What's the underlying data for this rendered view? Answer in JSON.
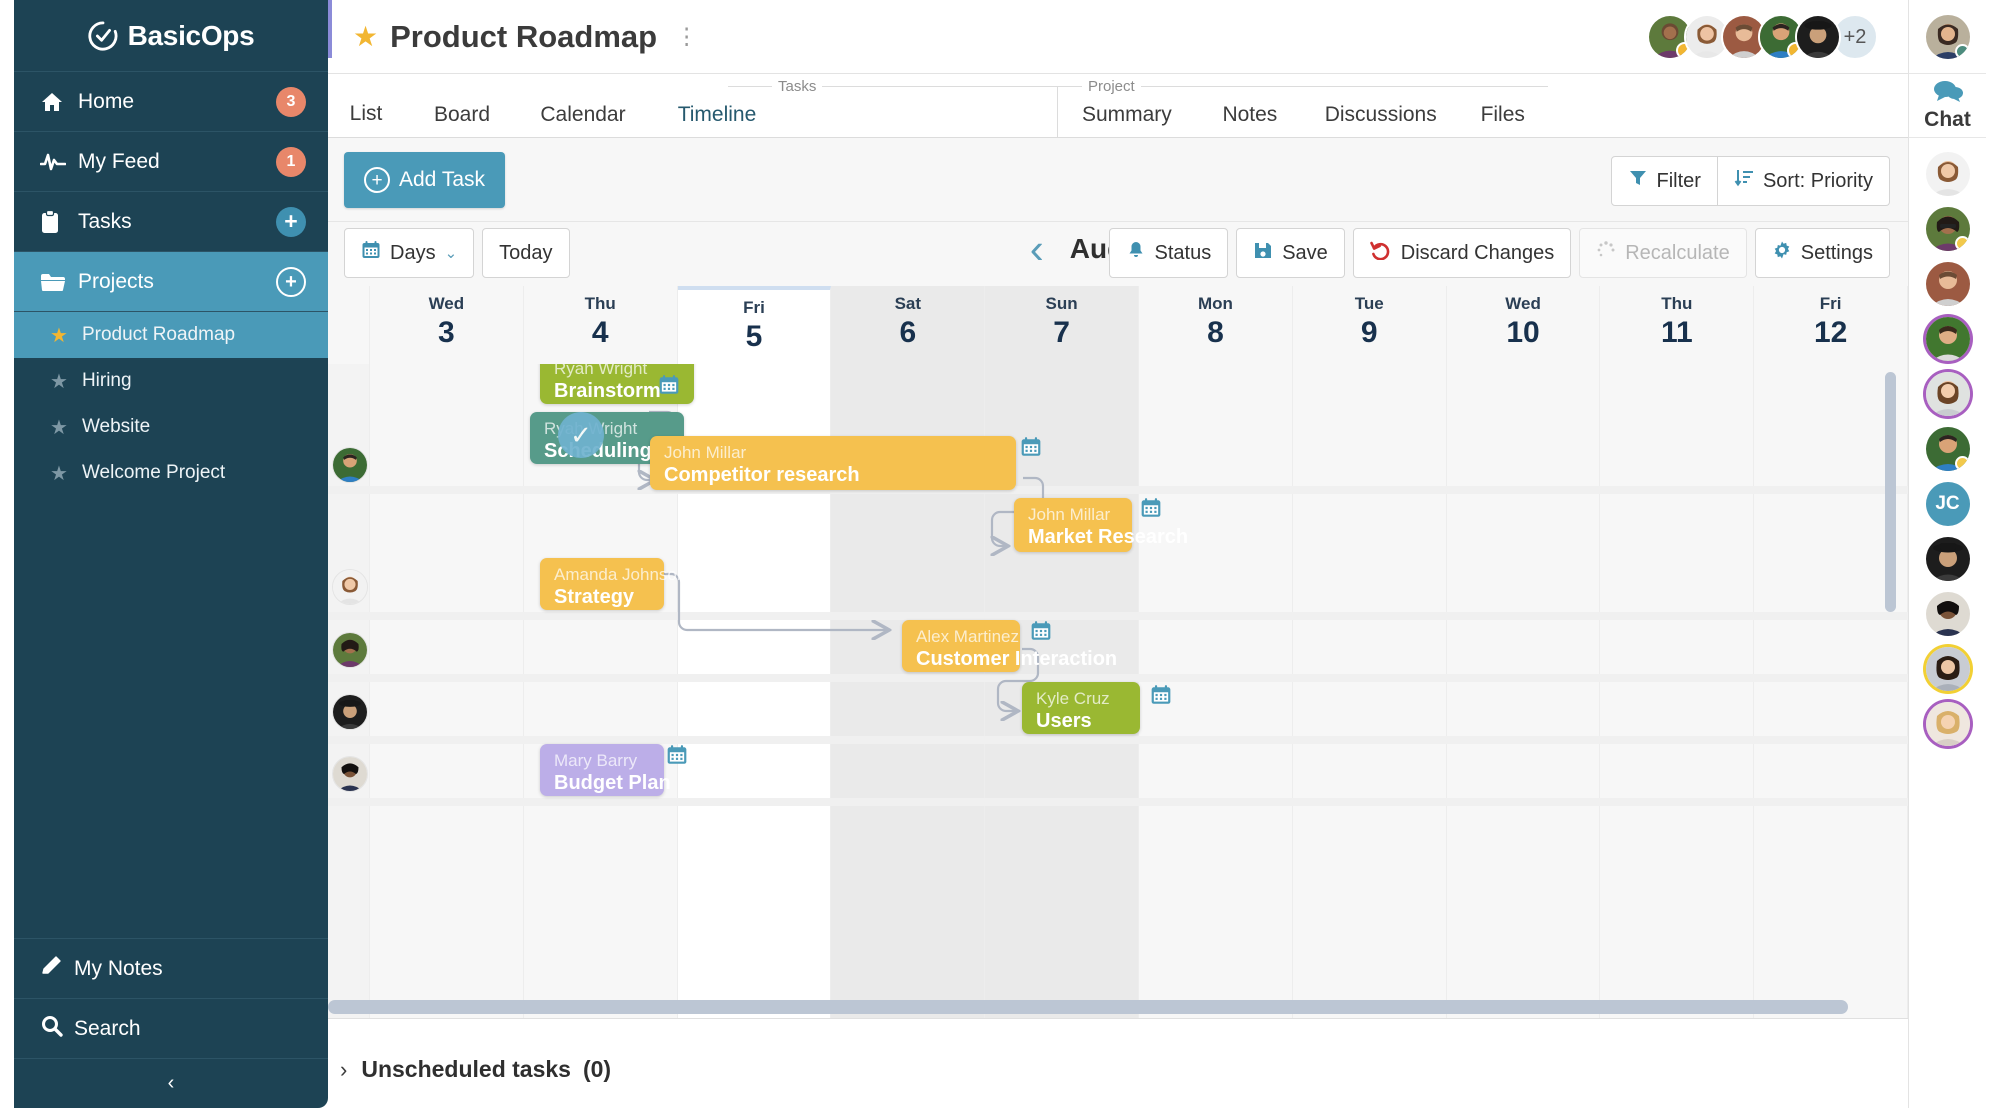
{
  "brand": {
    "name": "BasicOps",
    "logo_icon": "check-circle-icon"
  },
  "sidebar": {
    "items": [
      {
        "label": "Home",
        "icon": "home-icon",
        "badge": "3",
        "badge_type": "count"
      },
      {
        "label": "My Feed",
        "icon": "pulse-icon",
        "badge": "1",
        "badge_type": "count"
      },
      {
        "label": "Tasks",
        "icon": "clipboard-icon",
        "badge": "+",
        "badge_type": "plus-solid"
      },
      {
        "label": "Projects",
        "icon": "folder-icon",
        "badge": "+",
        "badge_type": "plus-ring",
        "active": true
      }
    ],
    "projects": [
      {
        "label": "Product Roadmap",
        "active": true
      },
      {
        "label": "Hiring",
        "active": false
      },
      {
        "label": "Website",
        "active": false
      },
      {
        "label": "Welcome Project",
        "active": false
      }
    ],
    "bottom": [
      {
        "label": "My Notes",
        "icon": "pencil-icon"
      },
      {
        "label": "Search",
        "icon": "search-icon"
      }
    ],
    "collapse_icon": "chevron-left-icon"
  },
  "header": {
    "star_icon": "star-icon",
    "title": "Product Roadmap",
    "kebab_icon": "kebab-menu-icon",
    "overflow_avatars": "+2"
  },
  "tabs": {
    "group_tasks_label": "Tasks",
    "group_project_label": "Project",
    "items": [
      {
        "label": "List",
        "selected": false
      },
      {
        "label": "Board",
        "selected": false
      },
      {
        "label": "Calendar",
        "selected": false
      },
      {
        "label": "Timeline",
        "selected": true
      },
      {
        "label": "Summary",
        "selected": false
      },
      {
        "label": "Notes",
        "selected": false
      },
      {
        "label": "Discussions",
        "selected": false
      },
      {
        "label": "Files",
        "selected": false
      }
    ]
  },
  "toolbar": {
    "add_task": "Add Task",
    "add_task_icon": "plus-circle-icon",
    "filter": "Filter",
    "filter_icon": "funnel-icon",
    "sort": "Sort: Priority",
    "sort_icon": "sort-icon"
  },
  "navrow": {
    "zoom_level": "Days",
    "zoom_icon": "calendar-icon",
    "zoom_caret": "chevron-down-icon",
    "today": "Today",
    "prev_icon": "chevron-left-icon",
    "month": "August",
    "next_icon": "chevron-right-icon",
    "actions": [
      {
        "label": "Status",
        "icon": "bell-icon",
        "disabled": false
      },
      {
        "label": "Save",
        "icon": "save-icon",
        "disabled": false
      },
      {
        "label": "Discard Changes",
        "icon": "undo-icon",
        "disabled": false
      },
      {
        "label": "Recalculate",
        "icon": "spinner-icon",
        "disabled": true
      },
      {
        "label": "Settings",
        "icon": "gear-icon",
        "disabled": false
      }
    ]
  },
  "chart_data": {
    "type": "gantt",
    "title": "Product Roadmap Timeline",
    "timescale": "Days",
    "month": "August",
    "today": "Fri 5",
    "columns": [
      {
        "dayname": "Wed",
        "daynum": "3",
        "weekend": false,
        "today": false
      },
      {
        "dayname": "Thu",
        "daynum": "4",
        "weekend": false,
        "today": false
      },
      {
        "dayname": "Fri",
        "daynum": "5",
        "weekend": false,
        "today": true
      },
      {
        "dayname": "Sat",
        "daynum": "6",
        "weekend": true,
        "today": false
      },
      {
        "dayname": "Sun",
        "daynum": "7",
        "weekend": true,
        "today": false
      },
      {
        "dayname": "Mon",
        "daynum": "8",
        "weekend": false,
        "today": false
      },
      {
        "dayname": "Tue",
        "daynum": "9",
        "weekend": false,
        "today": false
      },
      {
        "dayname": "Wed",
        "daynum": "10",
        "weekend": false,
        "today": false
      },
      {
        "dayname": "Thu",
        "daynum": "11",
        "weekend": false,
        "today": false
      },
      {
        "dayname": "Fri",
        "daynum": "12",
        "weekend": false,
        "today": false
      }
    ],
    "tasks": [
      {
        "assignee": "Ryah Wright",
        "name": "Brainstorm",
        "color": "#9ab832",
        "start_day": "5",
        "end_day": "5",
        "has_calendar_icon": false,
        "completed": false
      },
      {
        "assignee": "Ryah Wright",
        "name": "Scheduling",
        "color": "#579b8a",
        "start_day": "5",
        "end_day": "5",
        "has_calendar_icon": true,
        "completed": true
      },
      {
        "assignee": "John Millar",
        "name": "Competitor research",
        "color": "#f5c14f",
        "start_day": "5",
        "end_day": "8",
        "has_calendar_icon": true,
        "completed": false
      },
      {
        "assignee": "John Millar",
        "name": "Market Research",
        "color": "#f5c14f",
        "start_day": "9",
        "end_day": "9",
        "has_calendar_icon": true,
        "completed": false
      },
      {
        "assignee": "Amanda Johnson",
        "name": "Strategy",
        "color": "#f5c14f",
        "start_day": "5",
        "end_day": "5",
        "has_calendar_icon": false,
        "completed": false
      },
      {
        "assignee": "Alex Martinez",
        "name": "Customer Interaction",
        "color": "#f5c14f",
        "start_day": "8",
        "end_day": "8",
        "has_calendar_icon": true,
        "completed": false
      },
      {
        "assignee": "Kyle Cruz",
        "name": "Users",
        "color": "#9ab832",
        "start_day": "9",
        "end_day": "9",
        "has_calendar_icon": true,
        "completed": false
      },
      {
        "assignee": "Mary Barry",
        "name": "Budget Plan",
        "color": "#bcaee8",
        "start_day": "5",
        "end_day": "5",
        "has_calendar_icon": true,
        "completed": false
      }
    ],
    "dependencies": [
      {
        "from": "Scheduling",
        "to": "Competitor research"
      },
      {
        "from": "Competitor research",
        "to": "Market Research"
      },
      {
        "from": "Strategy",
        "to": "Customer Interaction"
      },
      {
        "from": "Customer Interaction",
        "to": "Users"
      }
    ]
  },
  "footer": {
    "chevron_icon": "chevron-right-icon",
    "label": "Unscheduled tasks",
    "count": "(0)"
  },
  "rail": {
    "chat_label": "Chat",
    "chat_icon": "chat-bubbles-icon",
    "initials_avatar": "JC"
  },
  "colors": {
    "sidebar_bg": "#1d4354",
    "accent": "#4a9ab8",
    "badge": "#e8876a",
    "star": "#f2b632",
    "task_green": "#9ab832",
    "task_teal": "#579b8a",
    "task_amber": "#f5c14f",
    "task_purple": "#bcaee8",
    "danger": "#cf3030"
  }
}
